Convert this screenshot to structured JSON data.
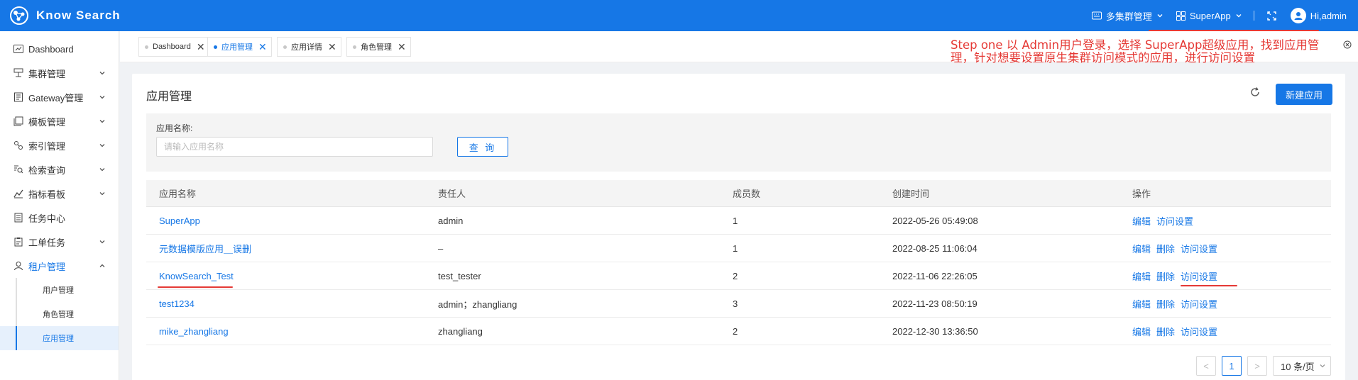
{
  "topbar": {
    "logo_text": "Know Search",
    "cluster_menu": "多集群管理",
    "app_menu": "SuperApp",
    "user_greeting": "Hi,admin",
    "bg_color": "#1677e6"
  },
  "sidebar": {
    "items": [
      {
        "label": "Dashboard",
        "icon": "dashboard-icon"
      },
      {
        "label": "集群管理",
        "icon": "cluster-icon"
      },
      {
        "label": "Gateway管理",
        "icon": "gateway-icon"
      },
      {
        "label": "模板管理",
        "icon": "template-icon"
      },
      {
        "label": "索引管理",
        "icon": "index-icon"
      },
      {
        "label": "检索查询",
        "icon": "search-query-icon"
      },
      {
        "label": "指标看板",
        "icon": "metrics-icon"
      },
      {
        "label": "任务中心",
        "icon": "task-icon"
      },
      {
        "label": "工单任务",
        "icon": "workorder-icon"
      },
      {
        "label": "租户管理",
        "icon": "tenant-icon"
      }
    ],
    "sub_items": [
      {
        "label": "用户管理"
      },
      {
        "label": "角色管理"
      },
      {
        "label": "应用管理"
      }
    ]
  },
  "tabs": [
    {
      "label": "Dashboard"
    },
    {
      "label": "应用管理"
    },
    {
      "label": "应用详情"
    },
    {
      "label": "角色管理"
    }
  ],
  "annotation": "Step one 以 Admin用户登录，选择 SuperApp超级应用，找到应用管理，针对想要设置原生集群访问模式的应用，进行访问设置",
  "page": {
    "title": "应用管理",
    "new_button": "新建应用",
    "filter_label": "应用名称:",
    "filter_placeholder": "请输入应用名称",
    "query_button": "查 询"
  },
  "table": {
    "headers": [
      "应用名称",
      "责任人",
      "成员数",
      "创建时间",
      "操作"
    ],
    "rows": [
      {
        "name": "SuperApp",
        "owner": "admin",
        "members": "1",
        "created": "2022-05-26 05:49:08",
        "ops": [
          "编辑",
          "访问设置"
        ]
      },
      {
        "name": "元数据模版应用＿误删",
        "owner": "–",
        "members": "1",
        "created": "2022-08-25 11:06:04",
        "ops": [
          "编辑",
          "删除",
          "访问设置"
        ]
      },
      {
        "name": "KnowSearch_Test",
        "owner": "test_tester",
        "members": "2",
        "created": "2022-11-06 22:26:05",
        "ops": [
          "编辑",
          "删除",
          "访问设置"
        ]
      },
      {
        "name": "test1234",
        "owner": "admin；zhangliang",
        "members": "3",
        "created": "2022-11-23 08:50:19",
        "ops": [
          "编辑",
          "删除",
          "访问设置"
        ]
      },
      {
        "name": "mike_zhangliang",
        "owner": "zhangliang",
        "members": "2",
        "created": "2022-12-30 13:36:50",
        "ops": [
          "编辑",
          "删除",
          "访问设置"
        ]
      }
    ]
  },
  "pagination": {
    "prev": "<",
    "current_page": "1",
    "next": ">",
    "page_size": "10 条/页"
  }
}
